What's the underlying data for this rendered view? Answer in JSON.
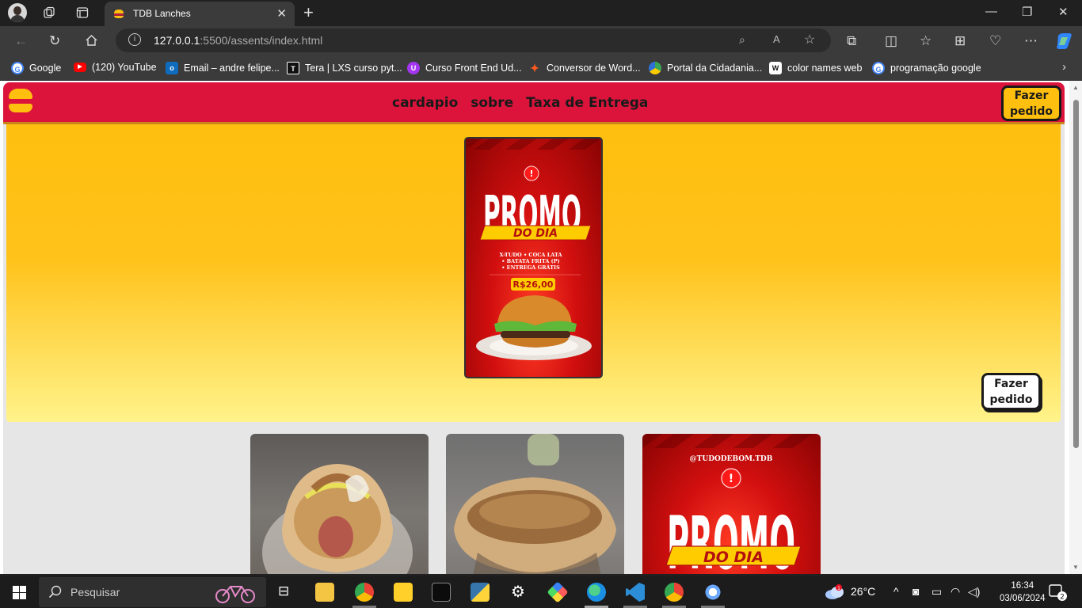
{
  "browser": {
    "tab_title": "TDB Lanches",
    "tab_close": "✕",
    "new_tab": "+",
    "url_host": "127.0.0.1",
    "url_path": ":5500/assents/index.html",
    "window_controls": {
      "minimize": "—",
      "maximize": "❐",
      "close": "✕"
    },
    "nav_icons": [
      "back-icon",
      "refresh-icon",
      "home-icon"
    ]
  },
  "bookmarks": [
    {
      "label": "Google",
      "icon": "google-icon",
      "color": "#4285f4"
    },
    {
      "label": "(120) YouTube",
      "icon": "youtube-icon",
      "color": "#ff0000"
    },
    {
      "label": "Email – andre felipe...",
      "icon": "outlook-icon",
      "color": "#0f6cbd"
    },
    {
      "label": "Tera | LXS curso pyt...",
      "icon": "tera-icon",
      "color": "#111111"
    },
    {
      "label": "Curso Front End Ud...",
      "icon": "udemy-icon",
      "color": "#a435f0"
    },
    {
      "label": "Conversor de Word...",
      "icon": "converter-icon",
      "color": "#ff5a1f"
    },
    {
      "label": "Portal da Cidadania...",
      "icon": "portal-icon",
      "color": "#3aa655"
    },
    {
      "label": "color names web",
      "icon": "w-icon",
      "color": "#ffffff"
    },
    {
      "label": "programação google",
      "icon": "google-icon",
      "color": "#4285f4"
    }
  ],
  "site": {
    "nav": [
      "cardapio",
      "sobre",
      "Taxa de Entrega"
    ],
    "order_button": "Fazer pedido",
    "order_button_floating": "Fazer pedido",
    "colors": {
      "header": "#dc143c",
      "accent": "#ffbf0f"
    }
  },
  "promo": {
    "handle": "@TUDODEBOM.TDB",
    "title": "PROMO",
    "subtitle": "DO DIA",
    "items": [
      "X-TUDO • COCA LATA",
      "• BATATA FRITA (P)",
      "• ENTREGA GRÁTIS"
    ],
    "price": "R$26,00"
  },
  "taskbar": {
    "search_placeholder": "Pesquisar",
    "weather": "26°C",
    "time": "16:34",
    "date": "03/06/2024",
    "notifications": "2",
    "weather_badge": "1"
  }
}
